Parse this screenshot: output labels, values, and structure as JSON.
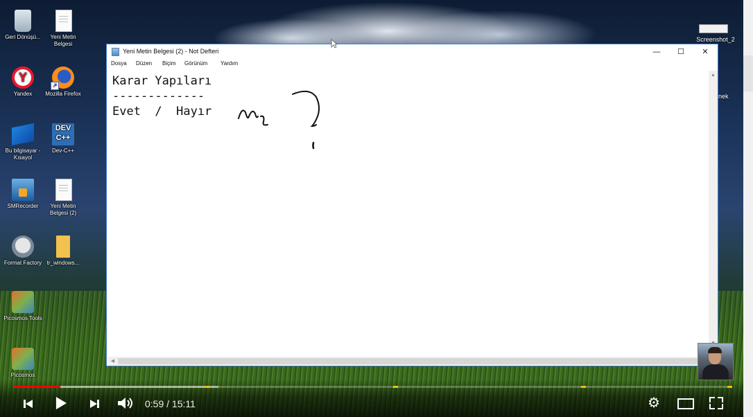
{
  "desktop": {
    "icons": [
      {
        "label": "Geri Dönüşü...",
        "icon": "recycle-bin-icon"
      },
      {
        "label": "Yeni Metin Belgesi",
        "icon": "text-document-icon"
      },
      {
        "label": "Yandex",
        "icon": "yandex-browser-icon"
      },
      {
        "label": "Mozilla Firefox",
        "icon": "firefox-icon"
      },
      {
        "label": "Bu bilgisayar - Kısayol",
        "icon": "this-pc-icon"
      },
      {
        "label": "Dev-C++",
        "icon": "dev-cpp-icon"
      },
      {
        "label": "SMRecorder",
        "icon": "smrecorder-icon"
      },
      {
        "label": "Yeni Metin Belgesi (2)",
        "icon": "text-document-icon"
      },
      {
        "label": "Format Factory",
        "icon": "format-factory-icon"
      },
      {
        "label": "tr_windows...",
        "icon": "folder-icon"
      },
      {
        "label": "Picosmos Tools",
        "icon": "picosmos-icon"
      },
      {
        "label": "Picosmos",
        "icon": "picosmos-icon"
      }
    ],
    "right_icons": [
      {
        "label": "Screenshot_2",
        "icon": "screenshot-icon"
      },
      {
        "label": "nek",
        "icon": "partial-icon"
      }
    ]
  },
  "notepad": {
    "title": "Yeni Metin Belgesi (2) - Not Defteri",
    "window_controls": {
      "minimize": "—",
      "maximize": "☐",
      "close": "✕"
    },
    "menu": [
      "Dosya",
      "Düzen",
      "Biçim",
      "Görünüm",
      "Yardım"
    ],
    "content": "Karar Yapıları\n-------------\nEvet  /  Hayır"
  },
  "player": {
    "time_current": "0:59",
    "time_total": "15:11",
    "time_separator": " / ",
    "played_fraction": 0.065,
    "loaded_fraction": 0.285,
    "chapter_markers": [
      0.265,
      0.528,
      0.79,
      1.0
    ],
    "colors": {
      "played": "#ff0000",
      "marker": "#f6c000"
    }
  }
}
